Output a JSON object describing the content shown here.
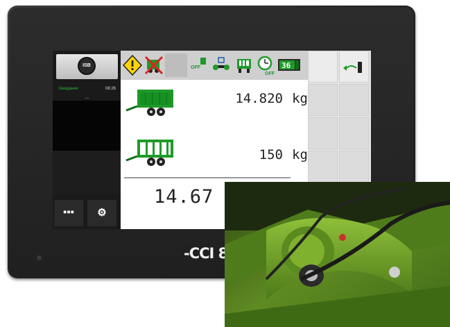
{
  "device": {
    "brand": "-CCI 8",
    "screen": {
      "isb_button_label": "ISB",
      "status": {
        "label": "Ожидание",
        "time": "08:26",
        "dots": "• •"
      },
      "left_buttons": [
        {
          "name": "menu",
          "glyph": "▪▪▪"
        },
        {
          "name": "settings",
          "glyph": "⚙"
        }
      ],
      "toolbar": {
        "items": [
          {
            "icon": "warning-icon"
          },
          {
            "icon": "no-loading-icon"
          },
          {
            "icon": "blank-icon"
          },
          {
            "icon": "off-unit-icon",
            "text": "OFF"
          },
          {
            "icon": "lock-axle-icon"
          },
          {
            "icon": "wagon-front-icon"
          },
          {
            "icon": "timer-off-icon",
            "text": "OFF"
          },
          {
            "icon": "counter-icon",
            "text": "36"
          }
        ]
      },
      "rows": [
        {
          "icon": "loader-wagon-full-icon",
          "value": "14.820",
          "unit": "kg"
        },
        {
          "icon": "loader-wagon-empty-icon",
          "value": "150",
          "unit": "kg"
        }
      ],
      "total": {
        "value": "14.67"
      },
      "soft_keys": [
        {
          "icon": "exit-icon"
        }
      ]
    }
  },
  "colors": {
    "green": "#1f9a2a",
    "dark_green": "#0d6e18",
    "housing": "#262626",
    "screen_bg": "#ffffff"
  }
}
